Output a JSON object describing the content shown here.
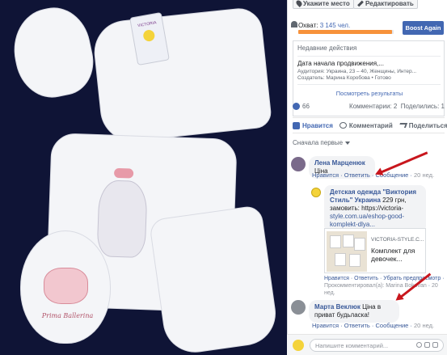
{
  "toolbar": {
    "location_button": "Укажите место",
    "edit_button": "Редактировать"
  },
  "reach": {
    "label": "Охват: ",
    "count": "3 145 чел.",
    "progress": 0.98,
    "boost_button": "Boost Again"
  },
  "recent_actions": {
    "title": "Недавние действия",
    "item_title": "Дата начала продвижения,...",
    "item_audience": "Аудитория: Украина, 23 – 40, Женщины, Интер...",
    "item_status": "Создатель: Марина Коробова • Готово",
    "view_results": "Посмотреть результаты"
  },
  "stats": {
    "like_count": "66",
    "comments": "Комментарии: 2",
    "shares": "Поделились: 1"
  },
  "actions": {
    "like": "Нравится",
    "comment": "Комментарий",
    "share": "Поделиться"
  },
  "sort_label": "Сначала первые",
  "comments": [
    {
      "author": "Лена Марценюк",
      "text": "Ціна",
      "like": "Нравится",
      "reply": "Ответить",
      "message": "Сообщение",
      "time": "20 нед."
    },
    {
      "author": "Марта Веклюк",
      "text": "Ціна в приват будьласка!",
      "like": "Нравится",
      "reply": "Ответить",
      "message": "Сообщение",
      "time": "20 нед."
    }
  ],
  "reply": {
    "author": "Детская одежда \"Виктория Стиль\" Украина",
    "line1": "229 грн,",
    "line2": "замовить: https://victoria-",
    "line3": "style.com.ua/eshop-good-",
    "line4": "komplekt-dlya...",
    "link_domain": "VICTORIA-STYLE.C...",
    "link_title": "Комплект для девочек...",
    "like": "Нравится",
    "reply_action": "Ответить",
    "hide_preview": "Убрать предпросмотр",
    "commented_by": "Прокомментировал(а): Marina Bokovan",
    "time": "20 нед."
  },
  "photo": {
    "tag_text": "VICTORIA",
    "bib_script": "Prima Ballerina"
  },
  "composer": {
    "placeholder": "Напишите комментарий..."
  },
  "colors": {
    "fb_blue": "#4267b2",
    "link_blue": "#385898",
    "progress_orange": "#f7923a",
    "arrow_red": "#c8161d",
    "photo_bg": "#0f1436"
  }
}
